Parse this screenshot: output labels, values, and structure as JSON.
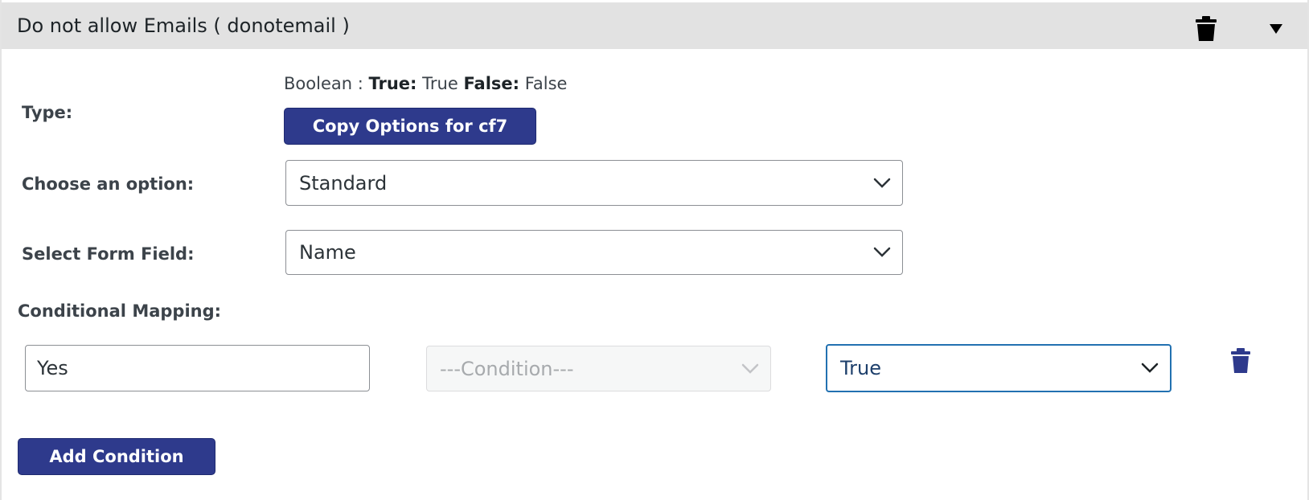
{
  "panel": {
    "title": "Do not allow Emails  ( donotemail )",
    "header_trash_icon": "trash-icon",
    "header_toggle_icon": "triangle-down-icon"
  },
  "type": {
    "label": "Type:",
    "desc_prefix": "Boolean :",
    "true_label": "True:",
    "true_value": "True",
    "false_label": "False:",
    "false_value": "False",
    "copy_button": "Copy Options for cf7"
  },
  "choose_option": {
    "label": "Choose an option:",
    "selected": "Standard"
  },
  "form_field": {
    "label": "Select Form Field:",
    "selected": "Name"
  },
  "conditional": {
    "label": "Conditional Mapping:",
    "value_input": "Yes",
    "condition_placeholder": "---Condition---",
    "result_selected": "True",
    "row_trash_icon": "trash-icon"
  },
  "add_condition_button": "Add Condition",
  "colors": {
    "primary_button": "#2e3a8c",
    "header_bg": "#e2e2e2",
    "focus_border": "#2271b1"
  }
}
